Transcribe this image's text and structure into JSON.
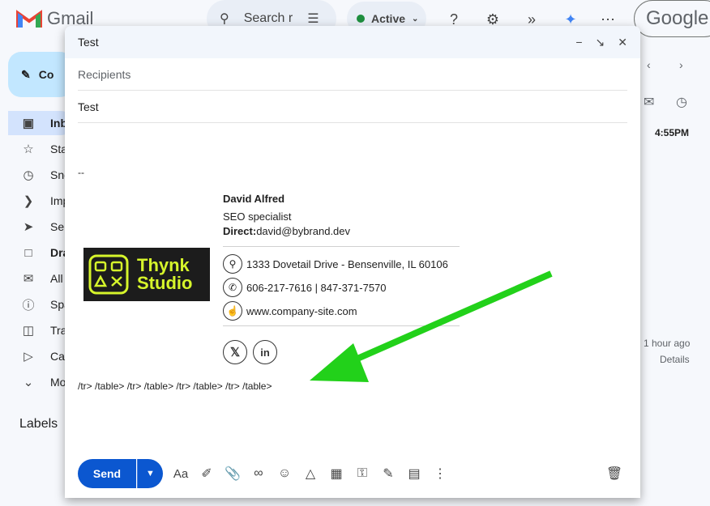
{
  "gmail": {
    "app_name": "Gmail",
    "search_placeholder": "Search r",
    "status_label": "Active",
    "google_label": "Google",
    "compose_label": "Co",
    "nav": [
      {
        "label": "Inb",
        "icon": "inbox-icon"
      },
      {
        "label": "Sta",
        "icon": "star-icon"
      },
      {
        "label": "Sno",
        "icon": "clock-icon"
      },
      {
        "label": "Imp",
        "icon": "label-important-icon"
      },
      {
        "label": "Ser",
        "icon": "send-icon"
      },
      {
        "label": "Dra",
        "icon": "draft-icon"
      },
      {
        "label": "All",
        "icon": "mail-icon"
      },
      {
        "label": "Spa",
        "icon": "spam-icon"
      },
      {
        "label": "Tra",
        "icon": "trash-icon"
      },
      {
        "label": "Cat",
        "icon": "label-icon"
      },
      {
        "label": "Mo",
        "icon": "chevron-down-icon"
      }
    ],
    "labels_heading": "Labels",
    "right_time": "4:55PM",
    "right_ago": "1 hour ago",
    "right_details": "Details"
  },
  "compose": {
    "window_title": "Test",
    "recipients_placeholder": "Recipients",
    "subject": "Test",
    "separator": "--",
    "signature": {
      "name": "David Alfred",
      "role": "SEO specialist",
      "direct_label": "Direct:",
      "direct_email": "david@bybrand.dev",
      "address": "1333 Dovetail Drive - Bensenville, IL 60106",
      "phones": "606-217-7616 | 847-371-7570",
      "website": "www.company-site.com",
      "logo_line1": "Thynk",
      "logo_line2": "Studio"
    },
    "stray_markup": "/tr> /table> /tr> /table> /tr> /table> /tr> /table>",
    "send_label": "Send",
    "format_label": "Aa"
  },
  "colors": {
    "send_blue": "#0b57d0",
    "arrow_green": "#22d11a",
    "logo_yellow": "#d6f52b"
  }
}
